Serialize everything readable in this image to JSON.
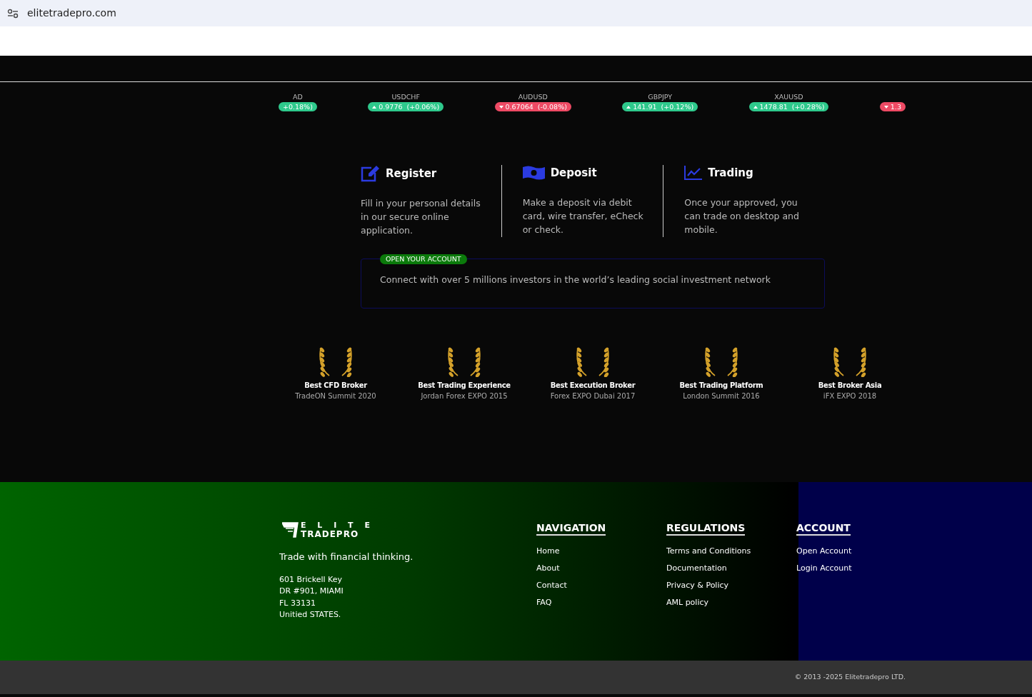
{
  "browser": {
    "url": "elitetradepro.com"
  },
  "ticker": [
    {
      "symbol": "AD",
      "quote": "+0.18%)",
      "rising": true
    },
    {
      "symbol": "USDCHF",
      "quote": "0.9776  (+0.06%)",
      "rising": true
    },
    {
      "symbol": "AUDUSD",
      "quote": "0.67064  (-0.08%)",
      "rising": false
    },
    {
      "symbol": "GBPJPY",
      "quote": "141.91  (+0.12%)",
      "rising": true
    },
    {
      "symbol": "XAUUSD",
      "quote": "1478.81  (+0.28%)",
      "rising": true
    },
    {
      "quote": "1.3",
      "rising": false
    }
  ],
  "steps": [
    {
      "kind": "register",
      "title": "Register",
      "text": "Fill in your personal details in our secure online application."
    },
    {
      "kind": "deposit",
      "title": "Deposit",
      "text": "Make a deposit via debit card, wire transfer, eCheck or check."
    },
    {
      "kind": "trading",
      "title": "Trading",
      "text": "Once your approved, you can trade on desktop and mobile."
    }
  ],
  "open_account": {
    "badge": "OPEN YOUR ACCOUNT",
    "text": "Connect with over 5 millions investors in the world’s leading social investment network"
  },
  "awards": [
    {
      "title": "Best CFD Broker",
      "event": "TradeON Summit 2020"
    },
    {
      "title": "Best Trading Experience",
      "event": "Jordan Forex EXPO 2015"
    },
    {
      "title": "Best Execution Broker",
      "event": "Forex EXPO Dubai 2017"
    },
    {
      "title": "Best Trading Platform",
      "event": "London Summit 2016"
    },
    {
      "title": "Best Broker Asia",
      "event": "iFX EXPO 2018"
    }
  ],
  "footer": {
    "logo_top": "E L I T E",
    "logo_bottom": "TRADEPRO",
    "tagline": "Trade with financial thinking.",
    "address": [
      "601 Brickell Key",
      "DR #901, MIAMI",
      "FL 33131",
      "Unitied STATES."
    ],
    "columns": [
      {
        "heading": "NAVIGATION",
        "links": [
          "Home",
          "About",
          "Contact",
          "FAQ"
        ]
      },
      {
        "heading": "REGULATIONS",
        "links": [
          "Terms and Conditions",
          "Documentation",
          "Privacy & Policy",
          "AML policy"
        ]
      },
      {
        "heading": "ACCOUNT",
        "links": [
          "Open Account",
          "Login Account"
        ]
      }
    ]
  },
  "copyright": "© 2013 -2025 Elitetradepro LTD."
}
